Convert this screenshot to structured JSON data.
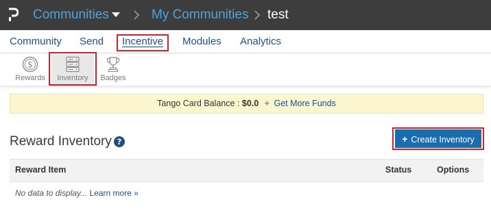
{
  "header": {
    "logo_icon": "p-logo-icon",
    "breadcrumbs": [
      {
        "label": "Communities"
      },
      {
        "label": "My Communities"
      },
      {
        "label": "test"
      }
    ]
  },
  "tabs": [
    {
      "label": "Community"
    },
    {
      "label": "Send"
    },
    {
      "label": "Incentive",
      "active": true
    },
    {
      "label": "Modules"
    },
    {
      "label": "Analytics"
    }
  ],
  "subnav": [
    {
      "label": "Rewards",
      "icon": "dollar-coin-icon"
    },
    {
      "label": "Inventory",
      "icon": "server-stack-icon",
      "active": true
    },
    {
      "label": "Badges",
      "icon": "trophy-icon"
    }
  ],
  "banner": {
    "balance_label": "Tango Card Balance :",
    "balance_value": "$0.0",
    "plus": "+",
    "funds_link": "Get More Funds"
  },
  "section": {
    "title": "Reward Inventory",
    "help_icon": "question-circle-icon",
    "create_plus": "+",
    "create_label": "Create Inventory"
  },
  "table": {
    "columns": [
      "Reward Item",
      "Status",
      "Options"
    ],
    "empty_text": "No data to display...",
    "learn_more": "Learn more »"
  },
  "colors": {
    "topbar": "#3d3d3d",
    "link": "#4fa3dc",
    "primary_button": "#1a6eb0",
    "highlight": "#d0202e",
    "banner": "#fcf6cf"
  }
}
